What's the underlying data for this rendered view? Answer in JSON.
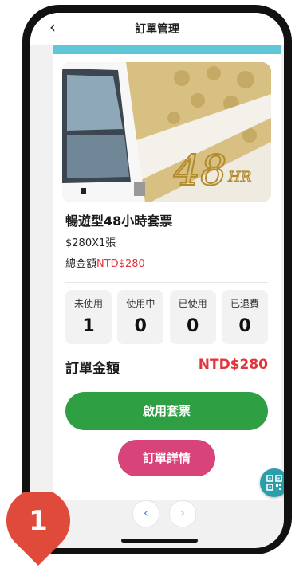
{
  "header": {
    "back_icon": "chevron-left-icon",
    "title": "訂單管理"
  },
  "banner": {
    "artwork_text": "48",
    "artwork_unit": "HR",
    "colors": {
      "gold": "#d8c083",
      "pattern": "#c4a862"
    }
  },
  "ticket": {
    "name": "暢遊型48小時套票",
    "price_line": "$280X1張",
    "total_label": "總金額",
    "total_value": "NTD$280"
  },
  "stats": [
    {
      "label": "未使用",
      "value": "1"
    },
    {
      "label": "使用中",
      "value": "0"
    },
    {
      "label": "已使用",
      "value": "0"
    },
    {
      "label": "已退費",
      "value": "0"
    }
  ],
  "order": {
    "label": "訂單金額",
    "amount": "NTD$280"
  },
  "buttons": {
    "activate": "啟用套票",
    "details": "訂單詳情"
  },
  "pager": {
    "prev": "‹",
    "next": "›"
  },
  "qr_button": {
    "icon": "qr-code-icon"
  },
  "step_badge": {
    "number": "1",
    "color": "#e04a3a"
  },
  "colors": {
    "accent_teal": "#5ec8d8",
    "green": "#2ea043",
    "pink": "#d8437a",
    "red": "#e0373d"
  }
}
